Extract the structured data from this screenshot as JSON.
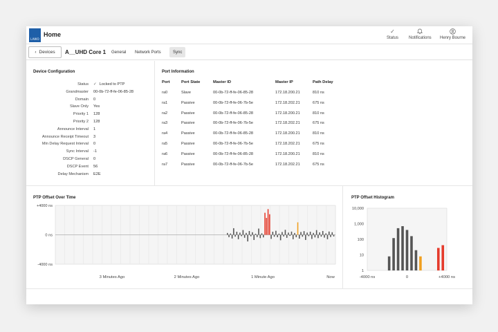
{
  "header": {
    "logo_text": "LAWO",
    "title": "Home",
    "status_label": "Status",
    "notifications_label": "Notifications",
    "user_label": "Henry Bourne"
  },
  "tabs_row": {
    "back_label": "Devices",
    "device_name": "A__UHD Core 1",
    "tabs": [
      {
        "label": "General"
      },
      {
        "label": "Network Ports"
      },
      {
        "label": "Sync"
      }
    ]
  },
  "device_config": {
    "title": "Device Configuration",
    "rows": [
      {
        "label": "Status",
        "value": "Locked to PTP"
      },
      {
        "label": "Grandmaster",
        "value": "00-0b-72-ff-fe-06-85-28"
      },
      {
        "label": "Domain",
        "value": "0"
      },
      {
        "label": "Slave Only",
        "value": "Yes"
      },
      {
        "label": "Priority 1",
        "value": "128"
      },
      {
        "label": "Priority 2",
        "value": "128"
      },
      {
        "label": "Announce Interval",
        "value": "1"
      },
      {
        "label": "Announce Receipt Timeout",
        "value": "3"
      },
      {
        "label": "Min Delay Request Interval",
        "value": "0"
      },
      {
        "label": "Sync Interval",
        "value": "-1"
      },
      {
        "label": "DSCP General",
        "value": "0"
      },
      {
        "label": "DSCP Event",
        "value": "56"
      },
      {
        "label": "Delay Mechanism",
        "value": "E2E"
      }
    ]
  },
  "port_info": {
    "title": "Port Information",
    "columns": [
      "Port",
      "Port State",
      "Master ID",
      "Master IP",
      "Path Delay"
    ],
    "rows": [
      [
        "ra0",
        "Slave",
        "00-0b-72-ff-fe-06-85-28",
        "172.18.200.21",
        "810 ns"
      ],
      [
        "ra1",
        "Passive",
        "00-0b-72-ff-fe-06-7b-5e",
        "172.18.202.21",
        "675 ns"
      ],
      [
        "ra2",
        "Passive",
        "00-0b-72-ff-fe-06-85-28",
        "172.18.200.21",
        "810 ns"
      ],
      [
        "ra3",
        "Passive",
        "00-0b-72-ff-fe-06-7b-5e",
        "172.18.202.21",
        "675 ns"
      ],
      [
        "ra4",
        "Passive",
        "00-0b-72-ff-fe-06-85-28",
        "172.18.200.21",
        "810 ns"
      ],
      [
        "ra5",
        "Passive",
        "00-0b-72-ff-fe-06-7b-5e",
        "172.18.202.21",
        "675 ns"
      ],
      [
        "ra6",
        "Passive",
        "00-0b-72-ff-fe-06-85-28",
        "172.18.200.21",
        "810 ns"
      ],
      [
        "ra7",
        "Passive",
        "00-0b-72-ff-fe-06-7b-5e",
        "172.18.202.21",
        "675 ns"
      ]
    ]
  },
  "colors": {
    "accent_blue": "#1f5fa8",
    "normal_bar": "#555555",
    "warn_bar": "#f0a020",
    "alert_bar": "#e53b2c"
  },
  "chart_data": [
    {
      "type": "bar",
      "title": "PTP Offset Over Time",
      "ylabel": "",
      "xlabel": "",
      "y_tick_labels": [
        "+4000 ns",
        "0 ns",
        "-4000 ns"
      ],
      "x_tick_labels": [
        "3 Minutes Ago",
        "2 Minutes Ago",
        "1 Minute Ago",
        "Now"
      ],
      "ylim": [
        -4000,
        4000
      ],
      "grid": true,
      "series": [
        {
          "values": [
            250,
            -320,
            180,
            -500,
            900,
            -250,
            420,
            -600,
            300,
            -180,
            650,
            -400,
            260,
            -900,
            520,
            -200,
            350,
            -700,
            150,
            -300,
            850,
            -450,
            200,
            -350,
            3000,
            2300,
            3500,
            2800,
            -550,
            420,
            -260,
            550,
            -320,
            160,
            -740,
            380,
            -220,
            680,
            -410,
            300,
            -150,
            440,
            -600,
            250,
            -330,
            1700,
            -520,
            380,
            -260,
            500,
            -700,
            300,
            -180,
            420,
            -560,
            260,
            -350,
            640,
            -450,
            330,
            -250,
            520,
            -380,
            200,
            -600,
            450,
            -300,
            350,
            -220
          ],
          "colors": [
            "normal",
            "normal",
            "normal",
            "normal",
            "normal",
            "normal",
            "normal",
            "normal",
            "normal",
            "normal",
            "normal",
            "normal",
            "normal",
            "normal",
            "normal",
            "normal",
            "normal",
            "normal",
            "normal",
            "normal",
            "normal",
            "normal",
            "normal",
            "normal",
            "alert",
            "alert",
            "alert",
            "alert",
            "normal",
            "normal",
            "normal",
            "normal",
            "normal",
            "normal",
            "normal",
            "normal",
            "normal",
            "normal",
            "normal",
            "normal",
            "normal",
            "normal",
            "normal",
            "normal",
            "normal",
            "warn",
            "normal",
            "normal",
            "normal",
            "normal",
            "normal",
            "normal",
            "normal",
            "normal",
            "normal",
            "normal",
            "normal",
            "normal",
            "normal",
            "normal",
            "normal",
            "normal",
            "normal",
            "normal",
            "normal",
            "normal",
            "normal",
            "normal",
            "normal"
          ]
        }
      ]
    },
    {
      "type": "bar",
      "title": "PTP Offset Histogram",
      "y_scale": "log",
      "ylim": [
        1,
        10000
      ],
      "y_tick_labels": [
        "10,000",
        "1,000",
        "100",
        "10",
        "1"
      ],
      "x_tick_labels": [
        "-4000 ns",
        "0",
        "+4000 ns"
      ],
      "xlim": [
        -4000,
        4000
      ],
      "grid": false,
      "bars": [
        {
          "x": -1800,
          "count": 8,
          "color": "normal"
        },
        {
          "x": -1350,
          "count": 120,
          "color": "normal"
        },
        {
          "x": -900,
          "count": 520,
          "color": "normal"
        },
        {
          "x": -450,
          "count": 700,
          "color": "normal"
        },
        {
          "x": 0,
          "count": 400,
          "color": "normal"
        },
        {
          "x": 450,
          "count": 160,
          "color": "normal"
        },
        {
          "x": 900,
          "count": 20,
          "color": "normal"
        },
        {
          "x": 1350,
          "count": 8,
          "color": "warn"
        },
        {
          "x": 3150,
          "count": 28,
          "color": "alert"
        },
        {
          "x": 3600,
          "count": 42,
          "color": "alert"
        }
      ]
    }
  ]
}
